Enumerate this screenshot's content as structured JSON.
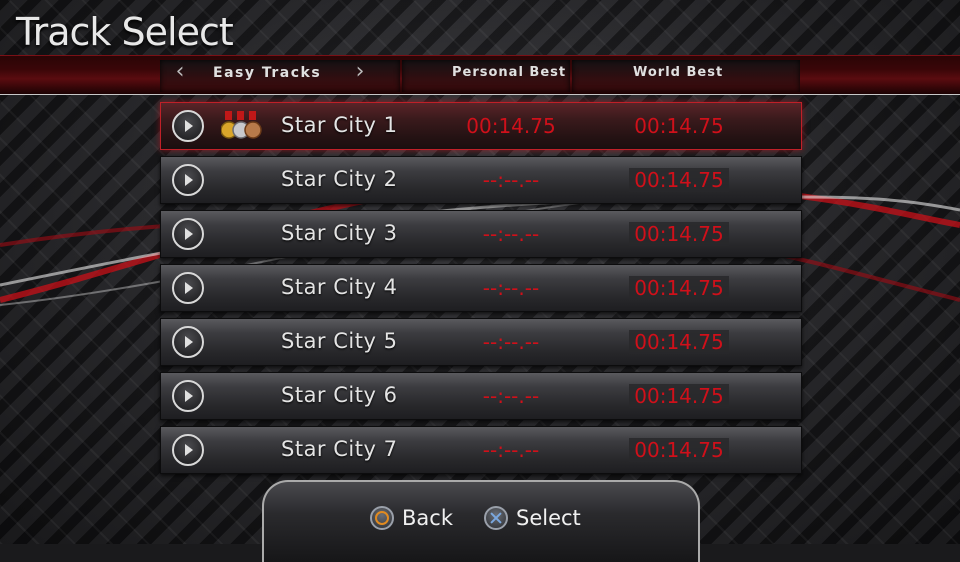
{
  "screen": {
    "title": "Track Select"
  },
  "header": {
    "category": "Easy  Tracks",
    "personal_best_label": "Personal Best",
    "world_best_label": "World Best"
  },
  "tracks": [
    {
      "name": "Star City 1",
      "personal_best": "00:14.75",
      "world_best": "00:14.75",
      "medals": true
    },
    {
      "name": "Star City 2",
      "personal_best": "--:--.--",
      "world_best": "00:14.75",
      "medals": false
    },
    {
      "name": "Star City 3",
      "personal_best": "--:--.--",
      "world_best": "00:14.75",
      "medals": false
    },
    {
      "name": "Star City 4",
      "personal_best": "--:--.--",
      "world_best": "00:14.75",
      "medals": false
    },
    {
      "name": "Star City 5",
      "personal_best": "--:--.--",
      "world_best": "00:14.75",
      "medals": false
    },
    {
      "name": "Star City 6",
      "personal_best": "--:--.--",
      "world_best": "00:14.75",
      "medals": false
    },
    {
      "name": "Star City 7",
      "personal_best": "--:--.--",
      "world_best": "00:14.75",
      "medals": false
    }
  ],
  "footer": {
    "back_label": "Back",
    "select_label": "Select"
  },
  "colors": {
    "time_red": "#d0101a",
    "accent_red": "#c02028",
    "circle_button": "#e08a20",
    "cross_button": "#7aa8e0"
  }
}
